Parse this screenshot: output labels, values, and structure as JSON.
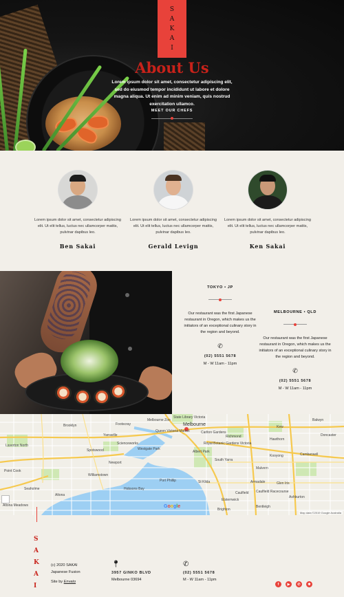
{
  "hero": {
    "logo_letters": [
      "S",
      "A",
      "K",
      "A",
      "I"
    ],
    "title": "About Us",
    "intro": "Lorem ipsum dolor sit amet, consectetur adipiscing elit, sed do eiusmod tempor incididunt ut labore et dolore magna aliqua. Ut enim ad minim veniam, quis nostrud exercitation ullamco.",
    "chefs_button": "MEET OUR CHEFS"
  },
  "team": [
    {
      "name": "Ben Sakai",
      "bio": "Lorem ipsum dolor sit amet, consectetur adipiscing elit. Ut elit tellus, luctus nec ullamcorper mattis, pulvinar dapibus leo."
    },
    {
      "name": "Gerald Levign",
      "bio": "Lorem ipsum dolor sit amet, consectetur adipiscing elit. Ut elit tellus, luctus nec ullamcorper mattis, pulvinar dapibus leo."
    },
    {
      "name": "Ken Sakai",
      "bio": "Lorem ipsum dolor sit amet, consectetur adipiscing elit. Ut elit tellus, luctus nec ullamcorper mattis, pulvinar dapibus leo."
    }
  ],
  "locations": [
    {
      "city": "TOKYO • JP",
      "text": "Our restaurant  was the first Japanese restaurant in Oregon, which makes us the initiators of an exceptional culinary story in the region and beyond.",
      "phone": "(02) 5551 5678",
      "hours": "M - W 11am - 11pm"
    },
    {
      "city": "MELBOURNE • QLD",
      "text": "Our restaurant  was the first Japanese restaurant in Oregon, which makes us the initiators of an exceptional culinary story in the region and beyond.",
      "phone": "(02) 5551 5678",
      "hours": "M - W 11am - 11pm"
    }
  ],
  "map": {
    "city_label": "Melbourne",
    "labels": [
      "Brooklyn",
      "Footscray",
      "Yarraville",
      "Spotswood",
      "Newport",
      "Williamstown",
      "Altona",
      "Laverton North",
      "Seaholme",
      "Altona Meadows",
      "Port Phillip",
      "Richmond",
      "Hawthorn",
      "Kew",
      "South Yarra",
      "Malvern",
      "Camberwell",
      "Glen Iris",
      "Ashburton",
      "Caulfield",
      "Elsternwick",
      "Brighton",
      "Bentleigh",
      "St Kilda",
      "Balwyn",
      "Kooyong",
      "State Library Victoria",
      "Queen Victoria Market",
      "Carlton Gardens",
      "Melbourne Zoo",
      "Albert Park",
      "Westgate Park",
      "Scienceworks",
      "Royal Botanic Gardens Victoria",
      "Caulfield Racecourse",
      "Armadale",
      "Doncaster",
      "Hobsons Bay",
      "Point Cook"
    ],
    "attribution": "Map data ©2019 Google   Australia",
    "google": [
      "G",
      "o",
      "o",
      "g",
      "l",
      "e"
    ]
  },
  "footer": {
    "logo_letters": [
      "S",
      "A",
      "K",
      "A",
      "I"
    ],
    "copyright": "(c) 2020 SAKAI",
    "tagline": "Japanese Fusion",
    "site_by_prefix": "Site by",
    "site_by_link": "Envato",
    "address_line1": "3957 GINKO BLVD",
    "address_line2": "Melbourne 03694",
    "phone": "(02) 5551 5678",
    "hours": "M - W 11am - 11pm",
    "socials": [
      "facebook-icon",
      "youtube-icon",
      "whatsapp-icon",
      "yelp-icon"
    ]
  },
  "colors": {
    "accent": "#e8423a",
    "title_red": "#c8221a",
    "background": "#f2efe9",
    "hero_dark": "#0f0f0f"
  }
}
